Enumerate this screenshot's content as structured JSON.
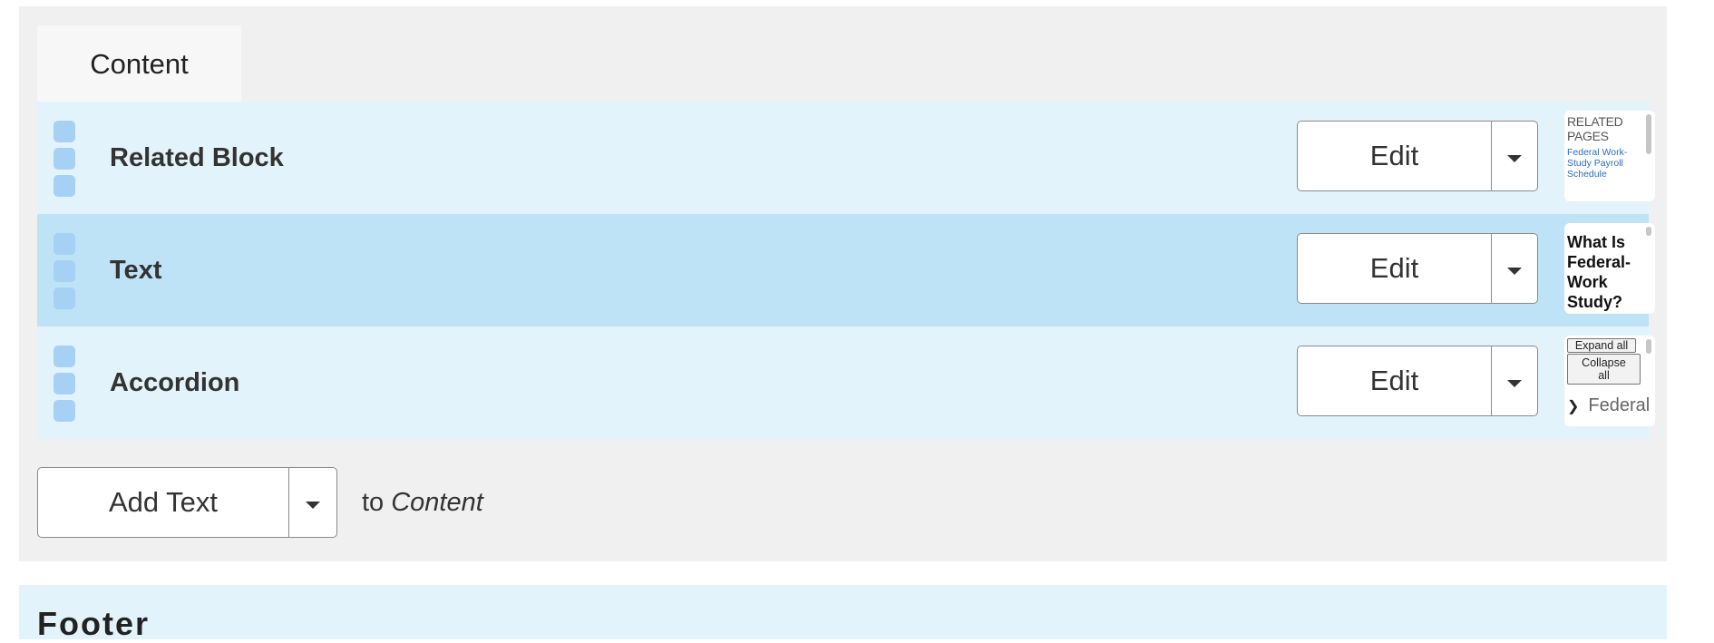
{
  "region": {
    "tab_label": "Content",
    "rows": [
      {
        "label": "Related Block",
        "edit_label": "Edit",
        "preview": {
          "heading": "RELATED PAGES",
          "link": "Federal Work-Study Payroll Schedule"
        }
      },
      {
        "label": "Text",
        "edit_label": "Edit",
        "preview": {
          "text": "What Is Federal-Work Study?"
        }
      },
      {
        "label": "Accordion",
        "edit_label": "Edit",
        "preview": {
          "expand_label": "Expand all",
          "collapse_label": "Collapse all",
          "item_label": "Federal"
        }
      }
    ],
    "add_button_label": "Add Text",
    "to_prefix": "to",
    "to_target": "Content"
  },
  "footer": {
    "title": "Footer"
  },
  "colors": {
    "row_bg": "#e3f3fc",
    "row_active_bg": "#bee2f6",
    "handle": "#a6d1f5",
    "panel_bg": "#f0f0f0"
  },
  "icons": {
    "drag_handle": "drag-handle-icon",
    "dropdown": "caret-down-icon",
    "accordion_chevron": "chevron-right-icon"
  }
}
